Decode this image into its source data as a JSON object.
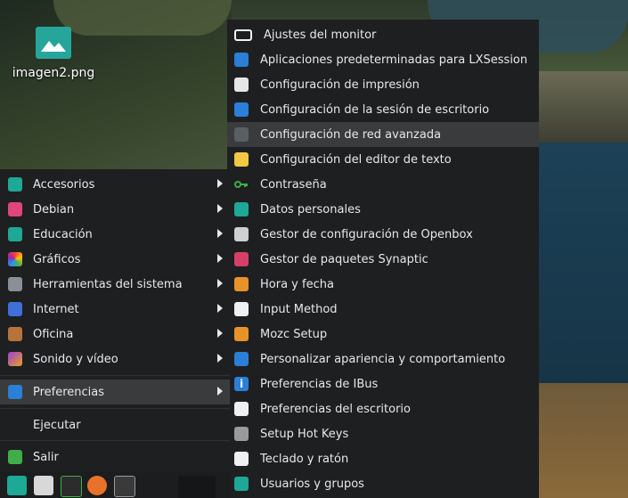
{
  "desktop": {
    "icon_label": "imagen2.png"
  },
  "main_menu": {
    "items": [
      {
        "label": "Accesorios",
        "icon": "accessories-icon",
        "submenu": true
      },
      {
        "label": "Debian",
        "icon": "debian-icon",
        "submenu": true
      },
      {
        "label": "Educación",
        "icon": "education-icon",
        "submenu": true
      },
      {
        "label": "Gráficos",
        "icon": "graphics-icon",
        "submenu": true
      },
      {
        "label": "Herramientas del sistema",
        "icon": "system-tools-icon",
        "submenu": true
      },
      {
        "label": "Internet",
        "icon": "internet-icon",
        "submenu": true
      },
      {
        "label": "Oficina",
        "icon": "office-icon",
        "submenu": true
      },
      {
        "label": "Sonido y vídeo",
        "icon": "multimedia-icon",
        "submenu": true
      },
      {
        "label": "Preferencias",
        "icon": "preferences-icon",
        "submenu": true
      },
      {
        "label": "Ejecutar",
        "icon": "run-icon",
        "submenu": false
      },
      {
        "label": "Salir",
        "icon": "logout-icon",
        "submenu": false
      }
    ]
  },
  "preferences_submenu": {
    "items": [
      {
        "label": "Ajustes del monitor",
        "icon": "monitor-icon"
      },
      {
        "label": "Aplicaciones predeterminadas para LXSession",
        "icon": "lxsession-icon"
      },
      {
        "label": "Configuración de impresión",
        "icon": "printer-icon"
      },
      {
        "label": "Configuración de la sesión de escritorio",
        "icon": "session-icon"
      },
      {
        "label": "Configuración de red avanzada",
        "icon": "network-icon"
      },
      {
        "label": "Configuración del editor de texto",
        "icon": "text-editor-icon"
      },
      {
        "label": "Contraseña",
        "icon": "key-icon"
      },
      {
        "label": "Datos personales",
        "icon": "person-icon"
      },
      {
        "label": "Gestor de configuración de Openbox",
        "icon": "openbox-icon"
      },
      {
        "label": "Gestor de paquetes Synaptic",
        "icon": "synaptic-icon"
      },
      {
        "label": "Hora y fecha",
        "icon": "clock-icon"
      },
      {
        "label": "Input Method",
        "icon": "keyboard-icon"
      },
      {
        "label": "Mozc Setup",
        "icon": "mozc-icon"
      },
      {
        "label": "Personalizar apariencia y comportamiento",
        "icon": "appearance-icon"
      },
      {
        "label": "Preferencias de IBus",
        "icon": "info-icon"
      },
      {
        "label": "Preferencias del escritorio",
        "icon": "desktop-prefs-icon"
      },
      {
        "label": "Setup Hot Keys",
        "icon": "hotkeys-icon"
      },
      {
        "label": "Teclado y ratón",
        "icon": "keyboard-mouse-icon"
      },
      {
        "label": "Usuarios y grupos",
        "icon": "users-icon"
      }
    ]
  },
  "taskbar": {
    "items": [
      "start-menu-icon",
      "file-manager-icon",
      "task-manager-icon",
      "firefox-icon",
      "terminal-icon"
    ]
  }
}
